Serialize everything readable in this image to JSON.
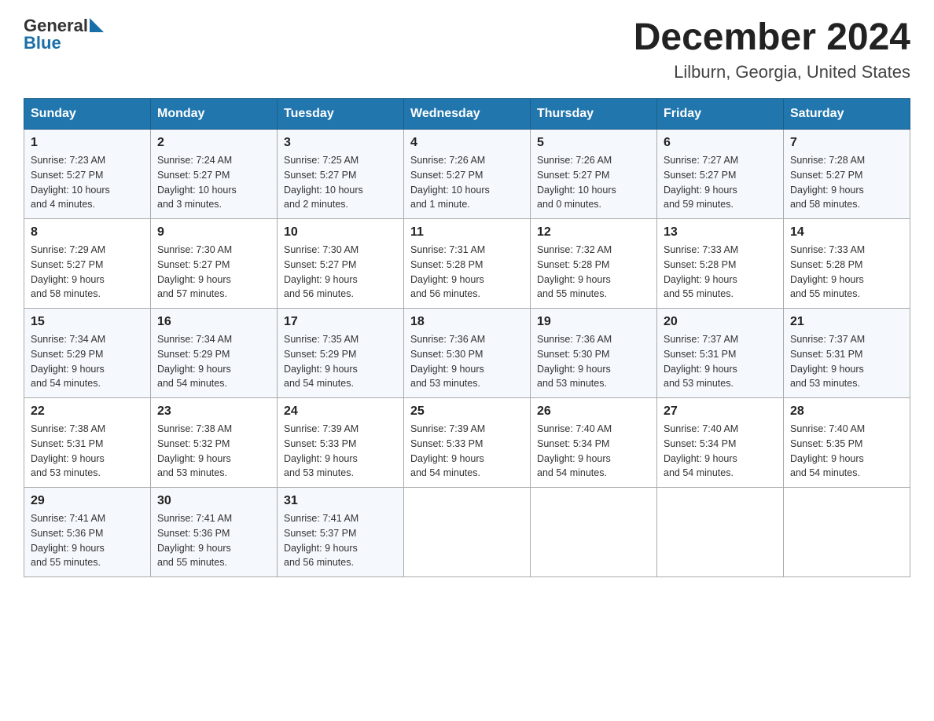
{
  "header": {
    "logo_general": "General",
    "logo_blue": "Blue",
    "title": "December 2024",
    "subtitle": "Lilburn, Georgia, United States"
  },
  "days_of_week": [
    "Sunday",
    "Monday",
    "Tuesday",
    "Wednesday",
    "Thursday",
    "Friday",
    "Saturday"
  ],
  "weeks": [
    [
      {
        "day": "1",
        "sunrise": "7:23 AM",
        "sunset": "5:27 PM",
        "daylight": "10 hours and 4 minutes."
      },
      {
        "day": "2",
        "sunrise": "7:24 AM",
        "sunset": "5:27 PM",
        "daylight": "10 hours and 3 minutes."
      },
      {
        "day": "3",
        "sunrise": "7:25 AM",
        "sunset": "5:27 PM",
        "daylight": "10 hours and 2 minutes."
      },
      {
        "day": "4",
        "sunrise": "7:26 AM",
        "sunset": "5:27 PM",
        "daylight": "10 hours and 1 minute."
      },
      {
        "day": "5",
        "sunrise": "7:26 AM",
        "sunset": "5:27 PM",
        "daylight": "10 hours and 0 minutes."
      },
      {
        "day": "6",
        "sunrise": "7:27 AM",
        "sunset": "5:27 PM",
        "daylight": "9 hours and 59 minutes."
      },
      {
        "day": "7",
        "sunrise": "7:28 AM",
        "sunset": "5:27 PM",
        "daylight": "9 hours and 58 minutes."
      }
    ],
    [
      {
        "day": "8",
        "sunrise": "7:29 AM",
        "sunset": "5:27 PM",
        "daylight": "9 hours and 58 minutes."
      },
      {
        "day": "9",
        "sunrise": "7:30 AM",
        "sunset": "5:27 PM",
        "daylight": "9 hours and 57 minutes."
      },
      {
        "day": "10",
        "sunrise": "7:30 AM",
        "sunset": "5:27 PM",
        "daylight": "9 hours and 56 minutes."
      },
      {
        "day": "11",
        "sunrise": "7:31 AM",
        "sunset": "5:28 PM",
        "daylight": "9 hours and 56 minutes."
      },
      {
        "day": "12",
        "sunrise": "7:32 AM",
        "sunset": "5:28 PM",
        "daylight": "9 hours and 55 minutes."
      },
      {
        "day": "13",
        "sunrise": "7:33 AM",
        "sunset": "5:28 PM",
        "daylight": "9 hours and 55 minutes."
      },
      {
        "day": "14",
        "sunrise": "7:33 AM",
        "sunset": "5:28 PM",
        "daylight": "9 hours and 55 minutes."
      }
    ],
    [
      {
        "day": "15",
        "sunrise": "7:34 AM",
        "sunset": "5:29 PM",
        "daylight": "9 hours and 54 minutes."
      },
      {
        "day": "16",
        "sunrise": "7:34 AM",
        "sunset": "5:29 PM",
        "daylight": "9 hours and 54 minutes."
      },
      {
        "day": "17",
        "sunrise": "7:35 AM",
        "sunset": "5:29 PM",
        "daylight": "9 hours and 54 minutes."
      },
      {
        "day": "18",
        "sunrise": "7:36 AM",
        "sunset": "5:30 PM",
        "daylight": "9 hours and 53 minutes."
      },
      {
        "day": "19",
        "sunrise": "7:36 AM",
        "sunset": "5:30 PM",
        "daylight": "9 hours and 53 minutes."
      },
      {
        "day": "20",
        "sunrise": "7:37 AM",
        "sunset": "5:31 PM",
        "daylight": "9 hours and 53 minutes."
      },
      {
        "day": "21",
        "sunrise": "7:37 AM",
        "sunset": "5:31 PM",
        "daylight": "9 hours and 53 minutes."
      }
    ],
    [
      {
        "day": "22",
        "sunrise": "7:38 AM",
        "sunset": "5:31 PM",
        "daylight": "9 hours and 53 minutes."
      },
      {
        "day": "23",
        "sunrise": "7:38 AM",
        "sunset": "5:32 PM",
        "daylight": "9 hours and 53 minutes."
      },
      {
        "day": "24",
        "sunrise": "7:39 AM",
        "sunset": "5:33 PM",
        "daylight": "9 hours and 53 minutes."
      },
      {
        "day": "25",
        "sunrise": "7:39 AM",
        "sunset": "5:33 PM",
        "daylight": "9 hours and 54 minutes."
      },
      {
        "day": "26",
        "sunrise": "7:40 AM",
        "sunset": "5:34 PM",
        "daylight": "9 hours and 54 minutes."
      },
      {
        "day": "27",
        "sunrise": "7:40 AM",
        "sunset": "5:34 PM",
        "daylight": "9 hours and 54 minutes."
      },
      {
        "day": "28",
        "sunrise": "7:40 AM",
        "sunset": "5:35 PM",
        "daylight": "9 hours and 54 minutes."
      }
    ],
    [
      {
        "day": "29",
        "sunrise": "7:41 AM",
        "sunset": "5:36 PM",
        "daylight": "9 hours and 55 minutes."
      },
      {
        "day": "30",
        "sunrise": "7:41 AM",
        "sunset": "5:36 PM",
        "daylight": "9 hours and 55 minutes."
      },
      {
        "day": "31",
        "sunrise": "7:41 AM",
        "sunset": "5:37 PM",
        "daylight": "9 hours and 56 minutes."
      },
      null,
      null,
      null,
      null
    ]
  ],
  "labels": {
    "sunrise": "Sunrise:",
    "sunset": "Sunset:",
    "daylight": "Daylight:"
  }
}
